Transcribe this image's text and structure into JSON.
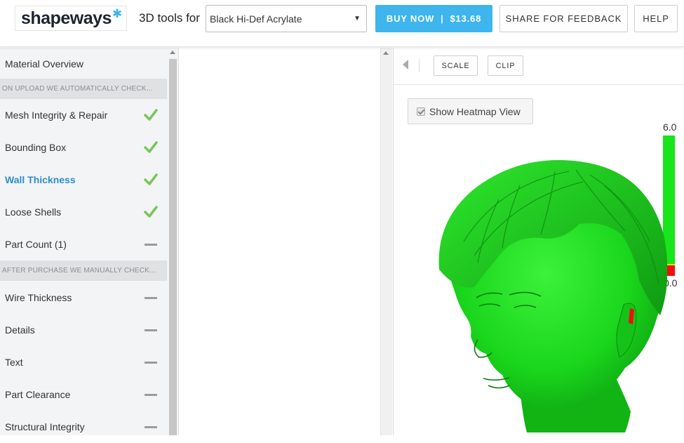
{
  "header": {
    "logo_text": "shapeways",
    "logo_star": "✱",
    "tools_label": "3D tools for",
    "material": {
      "selected": "Black Hi-Def Acrylate"
    },
    "buy": {
      "label": "BUY NOW",
      "separator": "|",
      "price": "$13.68"
    },
    "feedback_label": "SHARE FOR FEEDBACK",
    "help_label": "HELP",
    "colors": {
      "accent": "#3eb5ec"
    }
  },
  "sidebar": {
    "items": [
      {
        "label": "Material Overview",
        "status": "none"
      },
      {
        "section": "ON UPLOAD WE AUTOMATICALLY CHECK..."
      },
      {
        "label": "Mesh Integrity & Repair",
        "status": "check"
      },
      {
        "label": "Bounding Box",
        "status": "check"
      },
      {
        "label": "Wall Thickness",
        "status": "check",
        "active": true
      },
      {
        "label": "Loose Shells",
        "status": "check"
      },
      {
        "label": "Part Count (1)",
        "status": "dash"
      },
      {
        "section": "AFTER PURCHASE WE MANUALLY CHECK..."
      },
      {
        "label": "Wire Thickness",
        "status": "dash"
      },
      {
        "label": "Details",
        "status": "dash"
      },
      {
        "label": "Text",
        "status": "dash"
      },
      {
        "label": "Part Clearance",
        "status": "dash"
      },
      {
        "label": "Structural Integrity",
        "status": "dash"
      }
    ],
    "colors": {
      "check": "#7cc35a",
      "active": "#2d8ecb"
    }
  },
  "viewer": {
    "scale_label": "SCALE",
    "clip_label": "CLIP",
    "heatmap": {
      "label": "Show Heatmap View",
      "checked": true
    },
    "legend": {
      "max": "6.0",
      "min": "0.0"
    },
    "colors": {
      "ok": "#18e51a",
      "warn": "#e8e20f",
      "thin": "#ee1010"
    }
  }
}
